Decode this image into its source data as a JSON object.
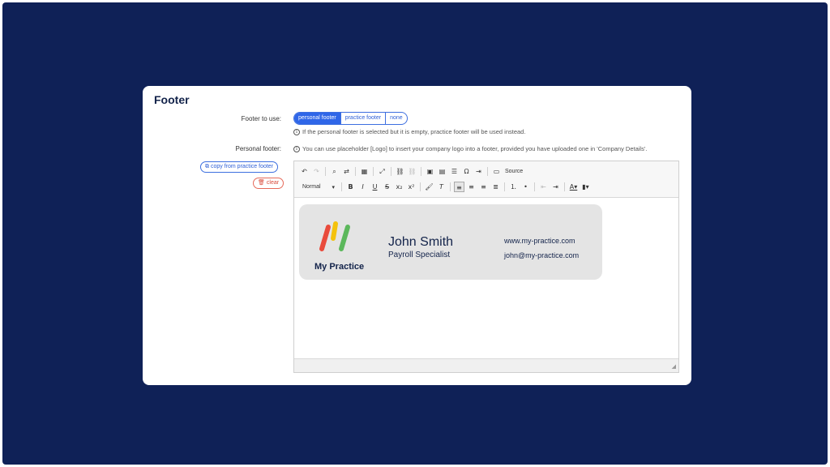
{
  "card": {
    "title": "Footer"
  },
  "footer_to_use": {
    "label": "Footer to use:",
    "options": [
      "personal footer",
      "practice footer",
      "none"
    ],
    "selected": "personal footer",
    "hint": "If the personal footer is selected but it is empty, practice footer will be used instead."
  },
  "personal_footer": {
    "label": "Personal footer:",
    "hint": "You can use placeholder [Logo] to insert your company logo into a footer, provided you have uploaded one in 'Company Details'.",
    "copy_button": "copy from practice footer",
    "clear_button": "clear"
  },
  "editor": {
    "toolbar_row1": [
      "undo-icon",
      "redo-icon",
      "find-icon",
      "replace-icon",
      "select-all-icon",
      "maximize-icon",
      "link-icon",
      "unlink-icon",
      "image-icon",
      "table-icon",
      "horizontal-rule-icon",
      "special-char-icon",
      "show-blocks-icon",
      "source-icon"
    ],
    "source_label": "Source",
    "format_value": "Normal",
    "toolbar_row2": [
      "bold-icon",
      "italic-icon",
      "underline-icon",
      "strike-icon",
      "subscript-icon",
      "superscript-icon",
      "copy-format-icon",
      "remove-format-icon",
      "align-left-icon",
      "align-center-icon",
      "align-right-icon",
      "justify-icon",
      "numbered-list-icon",
      "bulleted-list-icon",
      "outdent-icon",
      "indent-icon",
      "text-color-icon",
      "bg-color-icon"
    ]
  },
  "signature": {
    "logo_text": "My Practice",
    "name": "John Smith",
    "role": "Payroll Specialist",
    "website": "www.my-practice.com",
    "email": "john@my-practice.com"
  },
  "colors": {
    "background": "#0f2157",
    "accent": "#2f66e8",
    "danger": "#d94a3a",
    "logo_red": "#e94b3c",
    "logo_yellow": "#f4c20d",
    "logo_green": "#5cb85c",
    "text_dark": "#13234a"
  }
}
